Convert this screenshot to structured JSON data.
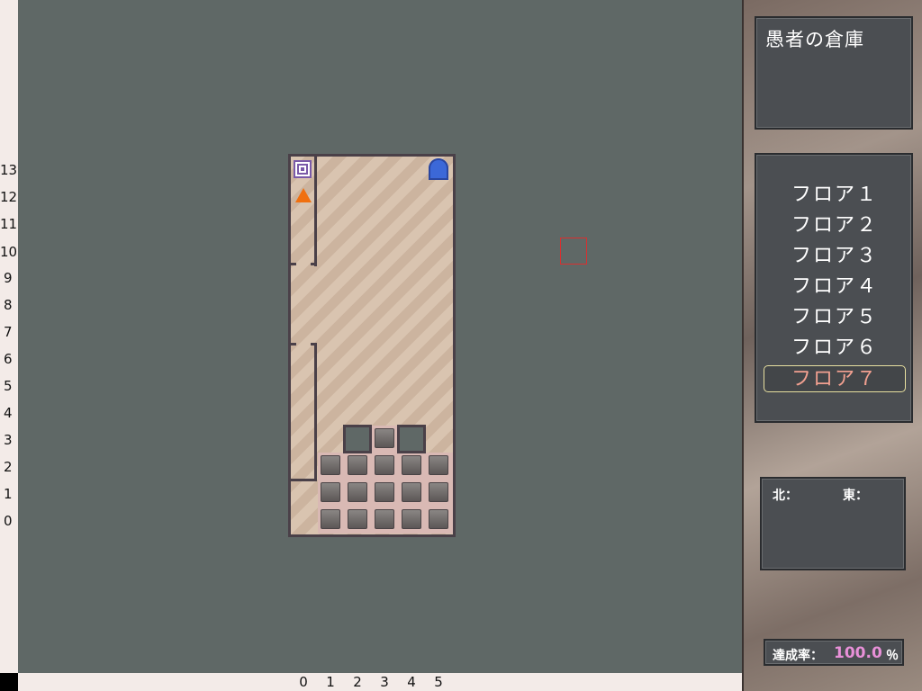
{
  "rows": [
    "13",
    "12",
    "11",
    "10",
    "9",
    "8",
    "7",
    "6",
    "5",
    "4",
    "3",
    "2",
    "1",
    "0"
  ],
  "cols": [
    "0",
    "1",
    "2",
    "3",
    "4",
    "5"
  ],
  "map": {
    "icons": [
      "stairs-icon",
      "door-icon",
      "player-icon",
      "block-icon",
      "pit-icon"
    ]
  },
  "sidebar": {
    "title": "愚者の倉庫",
    "floors": [
      "フロア１",
      "フロア２",
      "フロア３",
      "フロア４",
      "フロア５",
      "フロア６",
      "フロア７"
    ],
    "selected_floor": "フロア７",
    "north_label": "北：",
    "east_label": "東：",
    "rate_label": "達成率：",
    "rate_value": "100.0",
    "rate_unit": "％"
  },
  "colors": {
    "map_bg": "#5f6866",
    "wall": "#4a4048",
    "selected_floor_text": "#f2a090",
    "rate_value": "#e890d8",
    "player": "#f07010",
    "door": "#3c68d8"
  }
}
